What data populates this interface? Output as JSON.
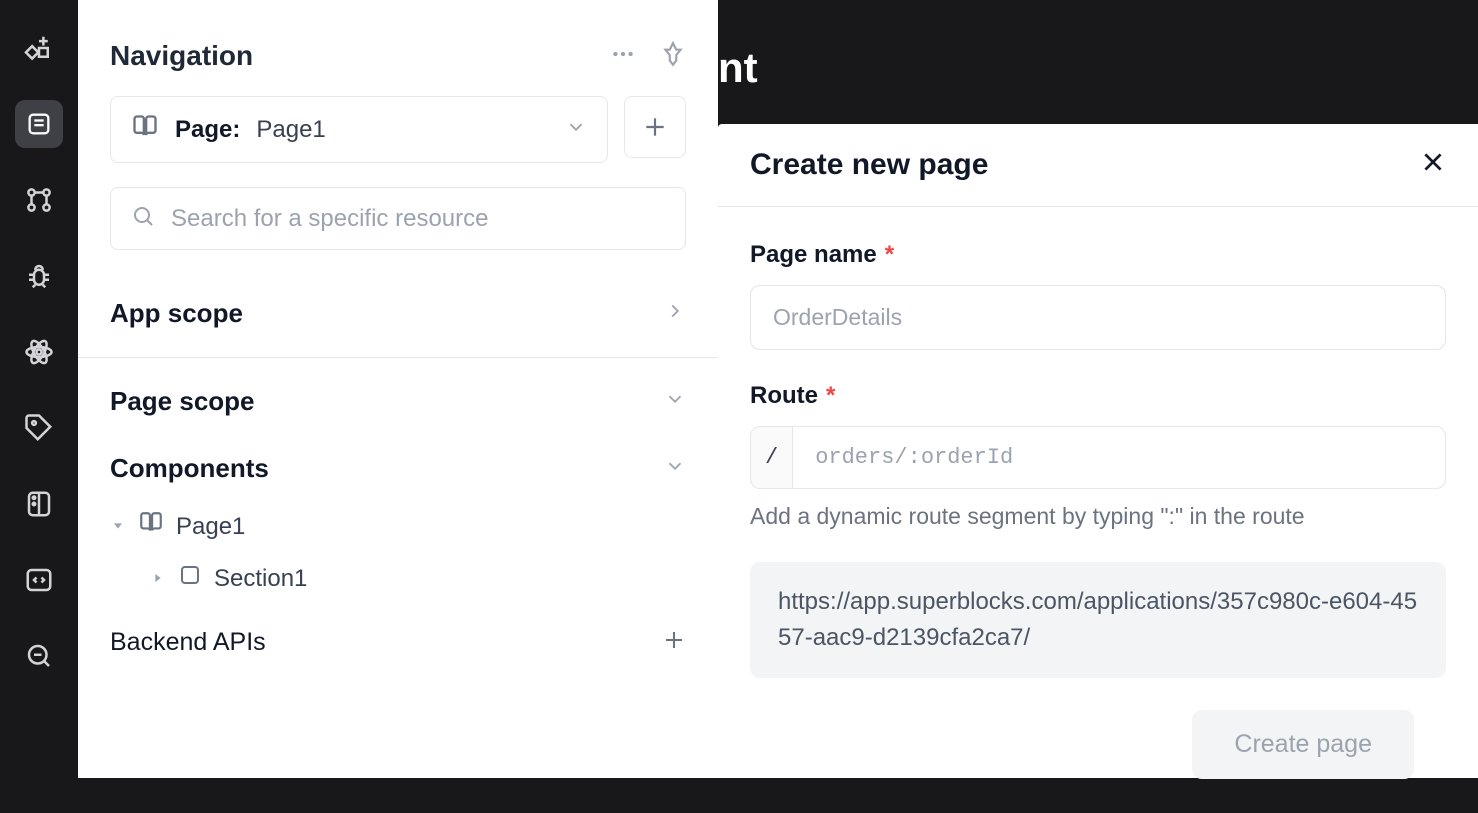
{
  "rail": {
    "icons": [
      "components-add-icon",
      "navigation-icon",
      "branch-icon",
      "bug-icon",
      "atom-icon",
      "tag-icon",
      "palette-icon",
      "code-icon",
      "search-db-icon"
    ]
  },
  "sidebar": {
    "title": "Navigation",
    "pageSelector": {
      "label": "Page:",
      "value": "Page1"
    },
    "search": {
      "placeholder": "Search for a specific resource"
    },
    "appScope": "App scope",
    "pageScope": "Page scope",
    "componentsTitle": "Components",
    "tree": {
      "page": "Page1",
      "section": "Section1"
    },
    "backendApis": "Backend APIs"
  },
  "bgTitle": "nt",
  "modal": {
    "title": "Create new page",
    "pageName": {
      "label": "Page name",
      "placeholder": "OrderDetails"
    },
    "route": {
      "label": "Route",
      "prefix": "/",
      "placeholder": "orders/:orderId",
      "helper": "Add a dynamic route segment by typing \":\" in the route"
    },
    "urlPreview": "https://app.superblocks.com/applications/357c980c-e604-4557-aac9-d2139cfa2ca7/",
    "createButton": "Create page"
  }
}
